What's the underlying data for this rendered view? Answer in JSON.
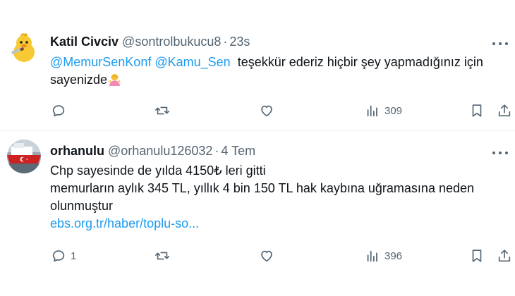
{
  "tweets": [
    {
      "author_name": "Katil Civciv",
      "handle": "@sontrolbukucu8",
      "separator": "·",
      "time": "23s",
      "text": {
        "mention_1": "@MemurSenKonf",
        "mention_2": "@Kamu_Sen",
        "text_1": "teşekkür ederiz hiçbir şey yapmadığınız için",
        "text_2": "sayenizde"
      },
      "emoji": "woman-shrugging-emoji",
      "avatar_icon": "duck-avatar-icon",
      "reply_count": "",
      "views": "309"
    },
    {
      "author_name": "orhanulu",
      "handle": "@orhanulu126032",
      "separator": "·",
      "time": "4 Tem",
      "text": {
        "line_1": "Chp sayesinde de yılda 4150₺ leri gitti",
        "line_2": "memurların aylık 345 TL, yıllık 4 bin 150 TL hak kaybına uğramasına neden",
        "line_3": "olunmuştur",
        "link": "ebs.org.tr/haber/toplu-so..."
      },
      "avatar_icon": "ship-flag-avatar-icon",
      "reply_count": "1",
      "views": "396"
    }
  ],
  "icons": [
    "reply-icon",
    "retweet-icon",
    "like-icon",
    "views-icon",
    "bookmark-icon",
    "share-icon",
    "more-icon"
  ],
  "colors": {
    "text": "#0f1419",
    "secondary": "#536471",
    "link": "#1d9bf0",
    "divider": "#eff3f4"
  }
}
